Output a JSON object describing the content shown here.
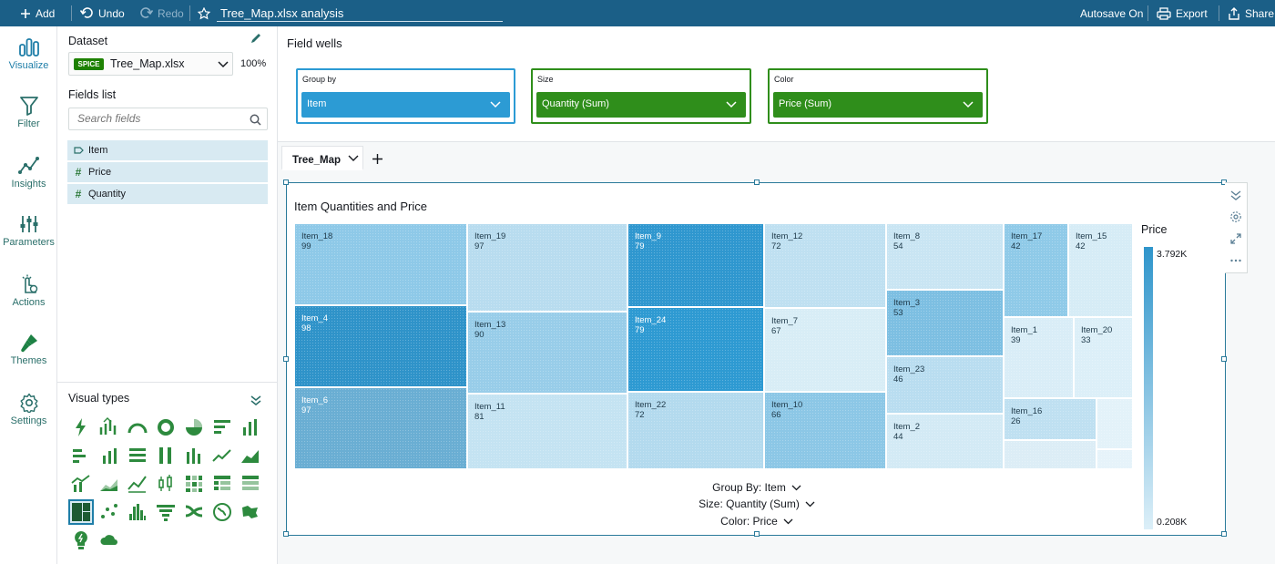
{
  "topbar": {
    "add_label": "Add",
    "undo_label": "Undo",
    "redo_label": "Redo",
    "analysis_title": "Tree_Map.xlsx analysis",
    "autosave_label": "Autosave On",
    "export_label": "Export",
    "share_label": "Share"
  },
  "leftnav": {
    "items": [
      {
        "label": "Visualize",
        "icon": "visualize-icon"
      },
      {
        "label": "Filter",
        "icon": "filter-icon"
      },
      {
        "label": "Insights",
        "icon": "insights-icon"
      },
      {
        "label": "Parameters",
        "icon": "parameters-icon"
      },
      {
        "label": "Actions",
        "icon": "actions-icon"
      },
      {
        "label": "Themes",
        "icon": "themes-icon"
      },
      {
        "label": "Settings",
        "icon": "settings-icon"
      }
    ]
  },
  "dataset": {
    "heading": "Dataset",
    "badge": "SPICE",
    "name": "Tree_Map.xlsx",
    "percent": "100%"
  },
  "fields": {
    "heading": "Fields list",
    "search_placeholder": "Search fields",
    "items": [
      {
        "label": "Item",
        "type": "dimension"
      },
      {
        "label": "Price",
        "type": "measure"
      },
      {
        "label": "Quantity",
        "type": "measure"
      }
    ]
  },
  "visual_types": {
    "heading": "Visual types",
    "selected": "tree-map"
  },
  "field_wells": {
    "heading": "Field wells",
    "group_by": {
      "label": "Group by",
      "value": "Item"
    },
    "size": {
      "label": "Size",
      "value": "Quantity (Sum)"
    },
    "color": {
      "label": "Color",
      "value": "Price (Sum)"
    }
  },
  "sheet": {
    "tab_label": "Tree_Map"
  },
  "visual": {
    "title": "Item Quantities and Price",
    "group_by_label": "Group By: Item",
    "size_label": "Size: Quantity (Sum)",
    "color_label": "Color: Price",
    "legend_title": "Price",
    "legend_max": "3.792K",
    "legend_min": "0.208K"
  },
  "colors": {
    "topbar": "#1b5f87",
    "accent_blue": "#1f7ea8",
    "group_by_well": "#2c9bd4",
    "size_color_well": "#2f8e1b",
    "legend_high": "#2f95cb",
    "legend_low": "#dceff8"
  },
  "chart_data": {
    "type": "treemap",
    "group_by": "Item",
    "size_measure": "Quantity (Sum)",
    "color_measure": "Price",
    "color_range": [
      "0.208K",
      "3.792K"
    ],
    "items": [
      {
        "name": "Item_18",
        "quantity": 99
      },
      {
        "name": "Item_4",
        "quantity": 98
      },
      {
        "name": "Item_6",
        "quantity": 97
      },
      {
        "name": "Item_19",
        "quantity": 97
      },
      {
        "name": "Item_13",
        "quantity": 90
      },
      {
        "name": "Item_11",
        "quantity": 81
      },
      {
        "name": "Item_9",
        "quantity": 79
      },
      {
        "name": "Item_24",
        "quantity": 79
      },
      {
        "name": "Item_22",
        "quantity": 72
      },
      {
        "name": "Item_12",
        "quantity": 72
      },
      {
        "name": "Item_7",
        "quantity": 67
      },
      {
        "name": "Item_10",
        "quantity": 66
      },
      {
        "name": "Item_8",
        "quantity": 54
      },
      {
        "name": "Item_3",
        "quantity": 53
      },
      {
        "name": "Item_23",
        "quantity": 46
      },
      {
        "name": "Item_2",
        "quantity": 44
      },
      {
        "name": "Item_17",
        "quantity": 42
      },
      {
        "name": "Item_15",
        "quantity": 42
      },
      {
        "name": "Item_1",
        "quantity": 39
      },
      {
        "name": "Item_20",
        "quantity": 33
      },
      {
        "name": "Item_16",
        "quantity": 26
      }
    ]
  }
}
